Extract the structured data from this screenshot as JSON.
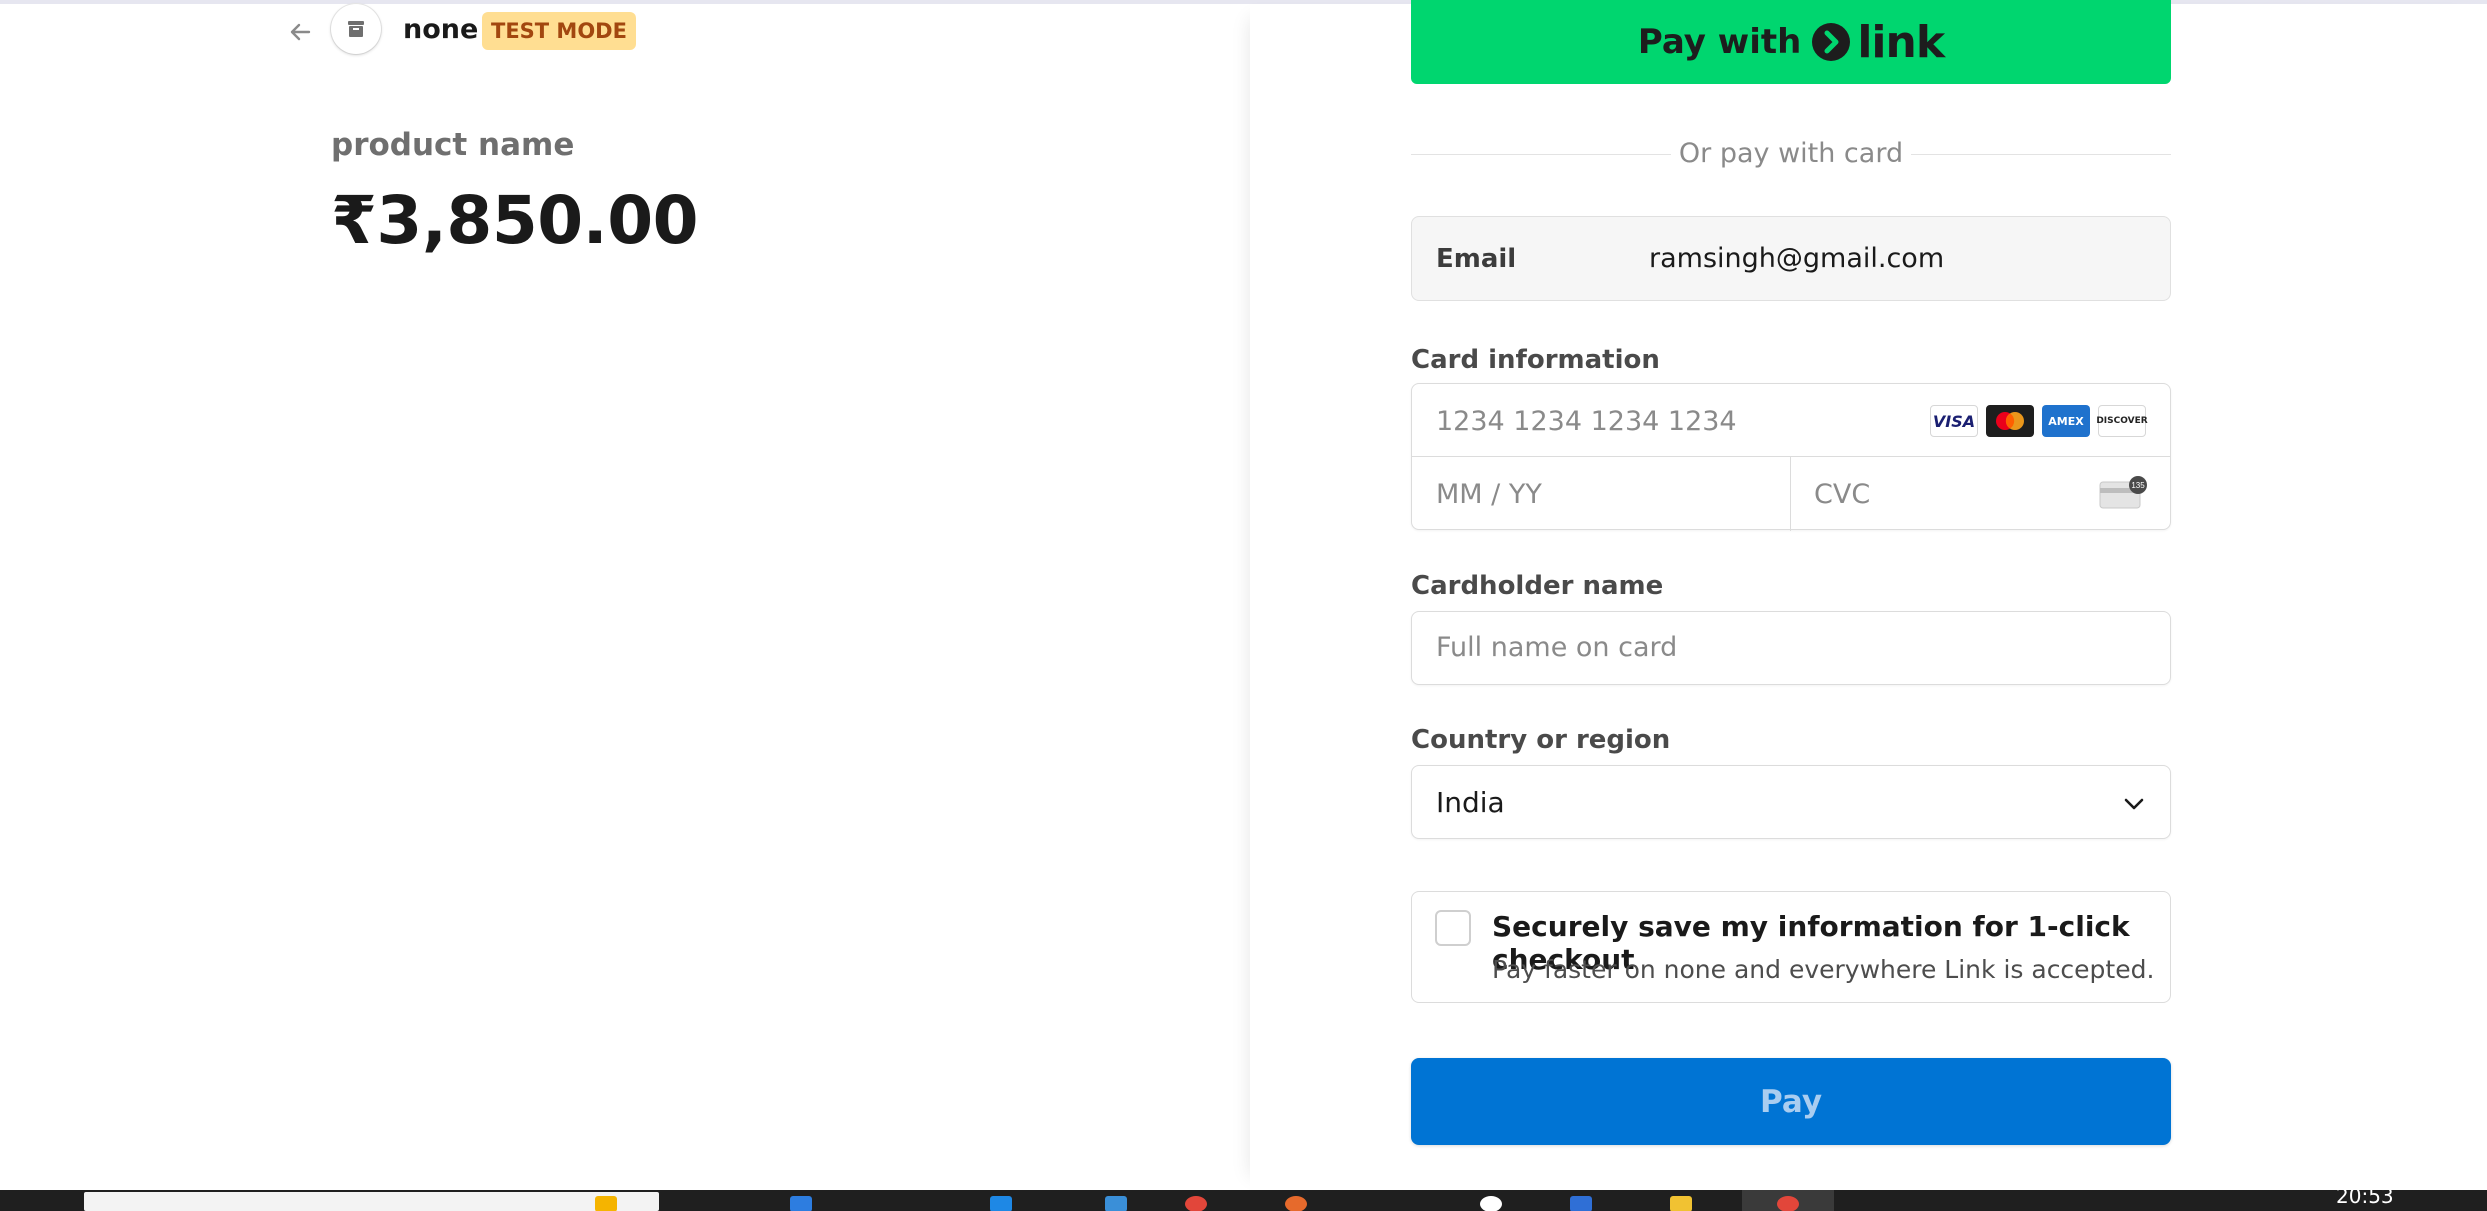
{
  "merchant": {
    "back_icon": "arrow-left-icon",
    "store_icon": "store-icon",
    "name": "none",
    "badge": "TEST MODE"
  },
  "product": {
    "name": "product name",
    "price": "₹3,850.00"
  },
  "checkout": {
    "link_button": {
      "prefix": "Pay with",
      "brand": "link"
    },
    "divider_text": "Or pay with card",
    "email": {
      "label": "Email",
      "value": "ramsingh@gmail.com"
    },
    "card": {
      "label": "Card information",
      "number_placeholder": "1234 1234 1234 1234",
      "expiry_placeholder": "MM / YY",
      "cvc_placeholder": "CVC",
      "brands": [
        "VISA",
        "mastercard",
        "AMEX",
        "DISCOVER"
      ],
      "cvc_icon_text": "135"
    },
    "cardholder": {
      "label": "Cardholder name",
      "placeholder": "Full name on card"
    },
    "country": {
      "label": "Country or region",
      "value": "India"
    },
    "save_info": {
      "title": "Securely save my information for 1-click checkout",
      "subtitle": "Pay faster on none and everywhere Link is accepted.",
      "checked": false
    },
    "pay_button": "Pay"
  },
  "colors": {
    "link_green": "#00d66f",
    "pay_blue": "#0074d4",
    "badge_bg": "#ffde92",
    "badge_text": "#a2470f"
  },
  "taskbar": {
    "clock": "20:53"
  }
}
